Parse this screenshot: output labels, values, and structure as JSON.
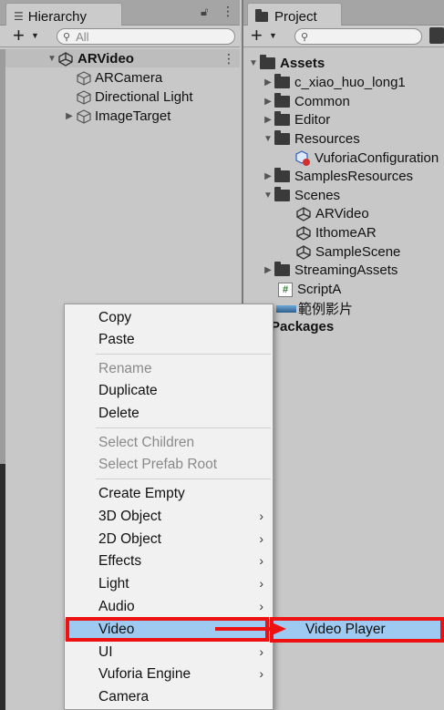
{
  "hierarchy": {
    "tab_label": "Hierarchy",
    "search_placeholder": "All",
    "root": "ARVideo",
    "children": [
      "ARCamera",
      "Directional Light",
      "ImageTarget"
    ]
  },
  "project": {
    "tab_label": "Project",
    "tree": {
      "assets": "Assets",
      "c_xiao": "c_xiao_huo_long1",
      "common": "Common",
      "editor": "Editor",
      "resources": "Resources",
      "vuforia_config": "VuforiaConfiguration",
      "samples_resources": "SamplesResources",
      "scenes": "Scenes",
      "scene1": "ARVideo",
      "scene2": "IthomeAR",
      "scene3": "SampleScene",
      "streaming": "StreamingAssets",
      "script": "ScriptA",
      "video": "範例影片",
      "packages": "Packages"
    }
  },
  "context_menu": {
    "copy": "Copy",
    "paste": "Paste",
    "rename": "Rename",
    "duplicate": "Duplicate",
    "delete": "Delete",
    "select_children": "Select Children",
    "select_prefab_root": "Select Prefab Root",
    "create_empty": "Create Empty",
    "obj3d": "3D Object",
    "obj2d": "2D Object",
    "effects": "Effects",
    "light": "Light",
    "audio": "Audio",
    "video": "Video",
    "ui": "UI",
    "vuforia": "Vuforia Engine",
    "camera": "Camera",
    "chevron": "›"
  },
  "submenu": {
    "video_player": "Video Player"
  },
  "colors": {
    "highlight": "#9ec9f0",
    "annotation_red": "#ee1111",
    "panel_bg": "#c8c8c8",
    "menu_bg": "#f1f1f1"
  }
}
